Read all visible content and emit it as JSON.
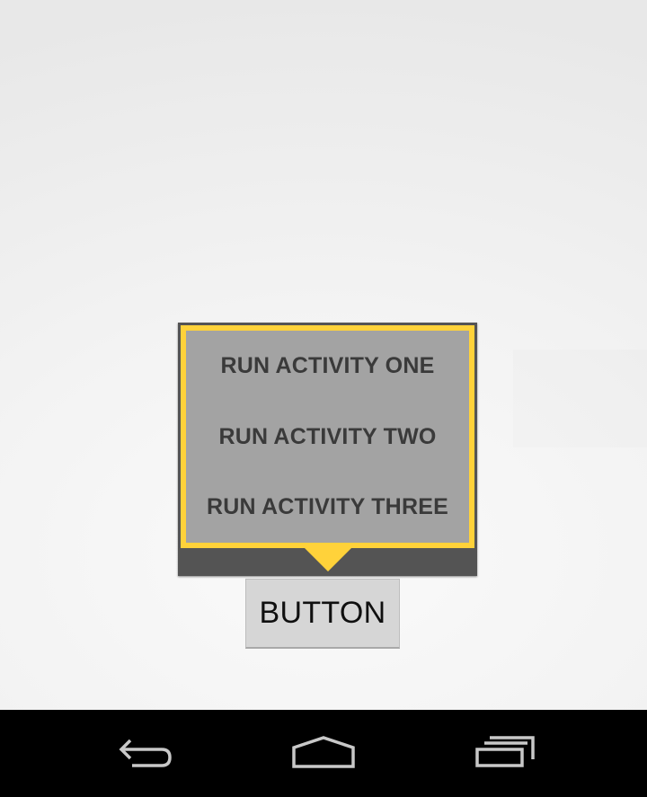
{
  "popup_menu": {
    "items": [
      {
        "label": "RUN ACTIVITY ONE"
      },
      {
        "label": "RUN ACTIVITY TWO"
      },
      {
        "label": "RUN ACTIVITY THREE"
      }
    ],
    "border_color": "#ffd23a",
    "background_color": "#a3a3a3"
  },
  "main": {
    "button_label": "BUTTON"
  },
  "nav_bar": {
    "back": {
      "icon": "back-arrow-icon"
    },
    "home": {
      "icon": "home-icon"
    },
    "recents": {
      "icon": "recent-apps-icon"
    }
  }
}
